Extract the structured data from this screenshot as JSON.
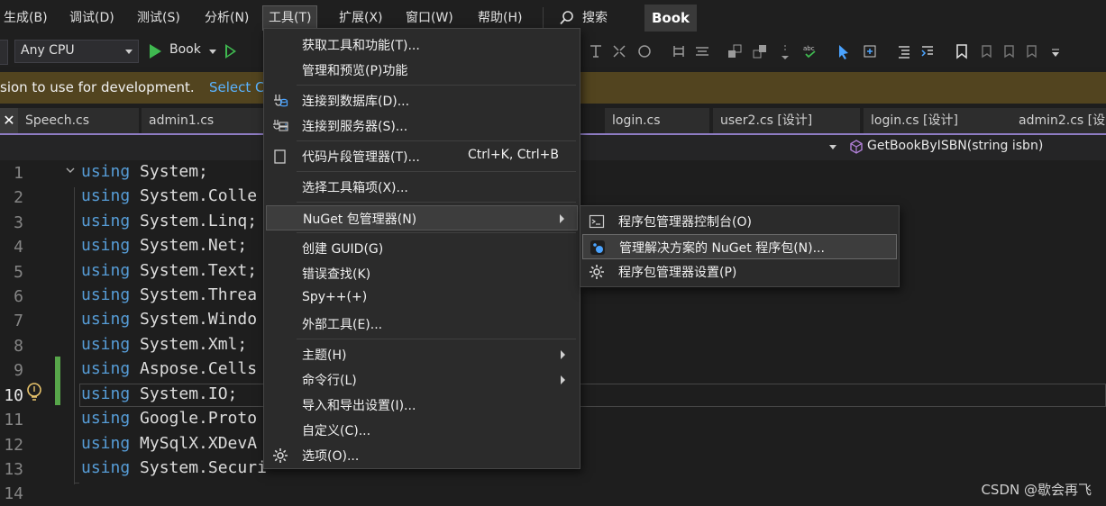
{
  "menubar": {
    "items": [
      "生成(B)",
      "调试(D)",
      "测试(S)",
      "分析(N)",
      "工具(T)",
      "扩展(X)",
      "窗口(W)",
      "帮助(H)"
    ],
    "search_label": "搜索",
    "solution_title": "Book"
  },
  "toolbar": {
    "platform": "Any CPU",
    "run_target": "Book"
  },
  "infobar": {
    "message": "sion to use for development.",
    "link": "Select C"
  },
  "tabs": [
    "Speech.cs",
    "admin1.cs",
    "login.cs",
    "user2.cs [设计]",
    "login.cs [设计]",
    "admin2.cs [设"
  ],
  "navbar": {
    "member": "GetBookByISBN(string isbn)"
  },
  "editor": {
    "line_numbers": [
      "1",
      "2",
      "3",
      "4",
      "5",
      "6",
      "7",
      "8",
      "9",
      "10",
      "11",
      "12",
      "13",
      "14"
    ],
    "lines": [
      {
        "kw": "using",
        "rest": " System;"
      },
      {
        "kw": "using",
        "rest": " System.Colle"
      },
      {
        "kw": "using",
        "rest": " System.Linq;"
      },
      {
        "kw": "using",
        "rest": " System.Net;"
      },
      {
        "kw": "using",
        "rest": " System.Text;"
      },
      {
        "kw": "using",
        "rest": " System.Threa"
      },
      {
        "kw": "using",
        "rest": " System.Windo"
      },
      {
        "kw": "using",
        "rest": " System.Xml;"
      },
      {
        "kw": "using",
        "rest": " Aspose.Cells"
      },
      {
        "kw": "using",
        "rest": " System.IO;"
      },
      {
        "kw": "using",
        "rest": " Google.Proto"
      },
      {
        "kw": "using",
        "rest": " MySqlX.XDevA"
      },
      {
        "kw": "using",
        "rest": " System.Securi"
      },
      {
        "kw": "",
        "rest": ""
      }
    ],
    "current_line": "10"
  },
  "tools_menu": {
    "items": [
      {
        "label": "获取工具和功能(T)...",
        "shortcut": "",
        "icon": "",
        "submenu": false
      },
      {
        "label": "管理和预览(P)功能",
        "shortcut": "",
        "icon": "",
        "submenu": false
      },
      {
        "label": "连接到数据库(D)...",
        "shortcut": "",
        "icon": "database-connect-icon",
        "submenu": false
      },
      {
        "label": "连接到服务器(S)...",
        "shortcut": "",
        "icon": "server-connect-icon",
        "submenu": false
      },
      {
        "label": "代码片段管理器(T)...",
        "shortcut": "Ctrl+K, Ctrl+B",
        "icon": "snippet-icon",
        "submenu": false
      },
      {
        "label": "选择工具箱项(X)...",
        "shortcut": "",
        "icon": "",
        "submenu": false
      },
      {
        "label": "NuGet 包管理器(N)",
        "shortcut": "",
        "icon": "",
        "submenu": true
      },
      {
        "label": "创建 GUID(G)",
        "shortcut": "",
        "icon": "",
        "submenu": false
      },
      {
        "label": "错误查找(K)",
        "shortcut": "",
        "icon": "",
        "submenu": false
      },
      {
        "label": "Spy++(+)",
        "shortcut": "",
        "icon": "",
        "submenu": false
      },
      {
        "label": "外部工具(E)...",
        "shortcut": "",
        "icon": "",
        "submenu": false
      },
      {
        "label": "主题(H)",
        "shortcut": "",
        "icon": "",
        "submenu": true
      },
      {
        "label": "命令行(L)",
        "shortcut": "",
        "icon": "",
        "submenu": true
      },
      {
        "label": "导入和导出设置(I)...",
        "shortcut": "",
        "icon": "",
        "submenu": false
      },
      {
        "label": "自定义(C)...",
        "shortcut": "",
        "icon": "",
        "submenu": false
      },
      {
        "label": "选项(O)...",
        "shortcut": "",
        "icon": "gear-icon",
        "submenu": false
      }
    ]
  },
  "nuget_submenu": {
    "items": [
      {
        "label": "程序包管理器控制台(O)",
        "icon": "console-icon"
      },
      {
        "label": "管理解决方案的 NuGet 程序包(N)...",
        "icon": "nuget-icon"
      },
      {
        "label": "程序包管理器设置(P)",
        "icon": "gear-icon"
      }
    ]
  },
  "watermark": "CSDN @歇会再飞",
  "colors": {
    "keyword": "#569cd6",
    "infobar": "#52441f",
    "change_bar": "#57a64a",
    "run_green": "#3fb950"
  }
}
